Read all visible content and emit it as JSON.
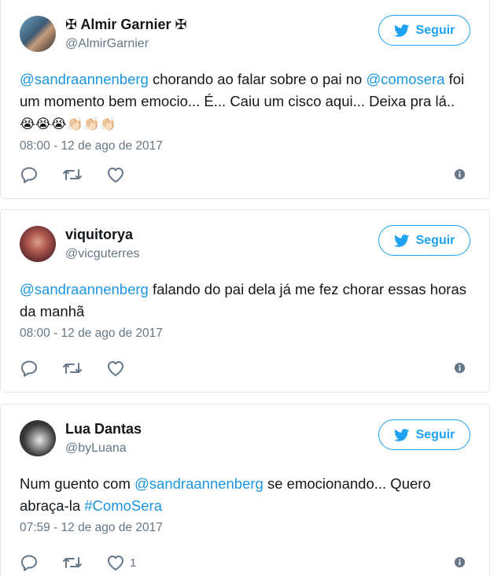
{
  "follow_label": "Seguir",
  "colors": {
    "accent": "#1da1f2",
    "link": "#1b95e0",
    "muted": "#657786",
    "text": "#14171a"
  },
  "tweets": [
    {
      "name": "✠ Almir Garnier ✠",
      "handle": "@AlmirGarnier",
      "text_parts": [
        {
          "type": "mention",
          "text": "@sandraannenberg"
        },
        {
          "type": "text",
          "text": " chorando ao falar sobre o pai no "
        },
        {
          "type": "mention",
          "text": "@comosera"
        },
        {
          "type": "text",
          "text": " foi um momento bem emocio... É... Caiu um cisco aqui... Deixa pra lá.. "
        },
        {
          "type": "emoji",
          "text": "😭😭😭👏🏻👏🏻👏🏻"
        }
      ],
      "date": "08:00 - 12 de ago de 2017",
      "like_count": ""
    },
    {
      "name": "viquitorya",
      "handle": "@vicguterres",
      "text_parts": [
        {
          "type": "mention",
          "text": "@sandraannenberg"
        },
        {
          "type": "text",
          "text": " falando do pai dela já me fez chorar essas horas da manhã"
        }
      ],
      "date": "08:00 - 12 de ago de 2017",
      "like_count": ""
    },
    {
      "name": "Lua Dantas",
      "handle": "@byLuana",
      "text_parts": [
        {
          "type": "text",
          "text": "Num guento com "
        },
        {
          "type": "mention",
          "text": "@sandraannenberg"
        },
        {
          "type": "text",
          "text": " se emocionando... Quero abraça-la "
        },
        {
          "type": "hashtag",
          "text": "#ComoSera"
        }
      ],
      "date": "07:59 - 12 de ago de 2017",
      "like_count": "1"
    }
  ]
}
